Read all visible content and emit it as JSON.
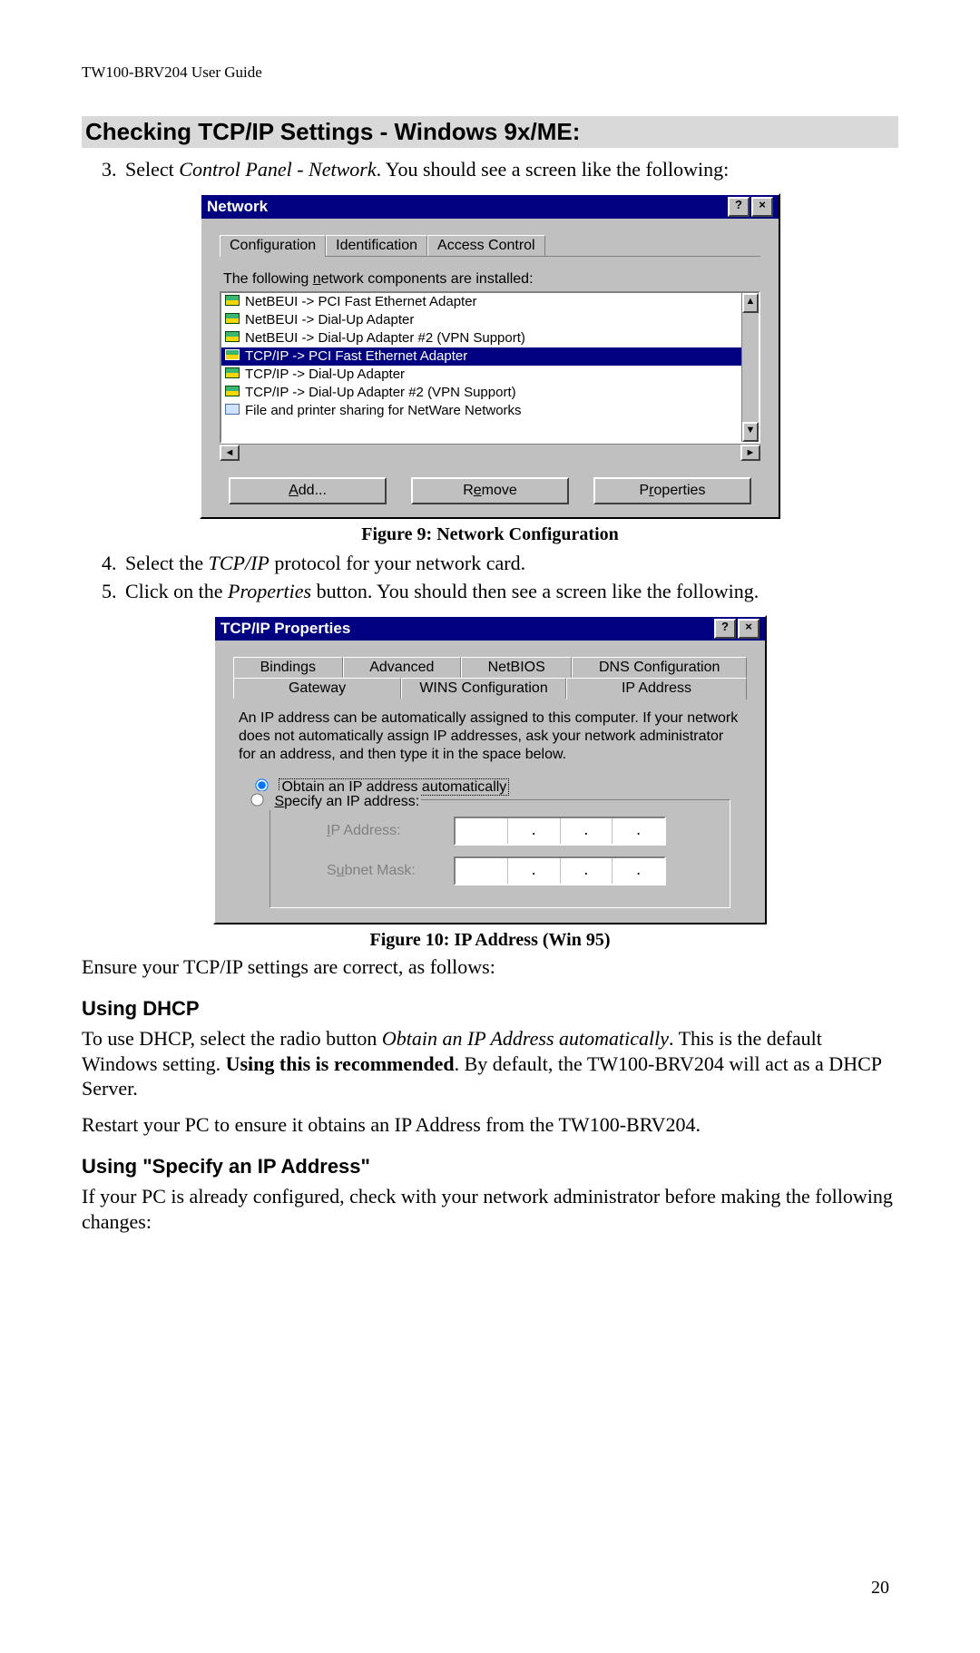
{
  "doc_header": "TW100-BRV204 User Guide",
  "section_title": "Checking TCP/IP Settings - Windows 9x/ME:",
  "step3_pre": "Select ",
  "step3_ital": "Control Panel - Network",
  "step3_post": ". You should see a screen like the following:",
  "fig9_caption": "Figure 9: Network Configuration",
  "step4_pre": "Select the ",
  "step4_ital": "TCP/IP",
  "step4_post": " protocol for your network card.",
  "step5_pre": "Click on the ",
  "step5_ital": "Properties",
  "step5_post": " button. You should then see a screen like the following.",
  "fig10_caption": "Figure 10: IP Address (Win 95)",
  "ensure_line": "Ensure your TCP/IP settings are correct, as follows:",
  "dhcp_heading": "Using DHCP",
  "dhcp_p_pre": "To use DHCP, select the radio button ",
  "dhcp_p_ital": "Obtain an IP Address automatically",
  "dhcp_p_mid": ". This is the default Windows setting. ",
  "dhcp_p_bold": "Using this is recommended",
  "dhcp_p_post": ". By default, the TW100-BRV204 will act as a DHCP Server.",
  "dhcp_restart": "Restart your PC to ensure it obtains an IP Address from the TW100-BRV204.",
  "specify_heading": "Using \"Specify an IP Address\"",
  "specify_p": "If your PC is already configured, check with your network administrator before making the following changes:",
  "page_number": "20",
  "win1": {
    "title": "Network",
    "help_btn": "?",
    "close_btn": "×",
    "tabs": [
      "Configuration",
      "Identification",
      "Access Control"
    ],
    "list_label_pre": "The following ",
    "list_label_ukey": "n",
    "list_label_post": "etwork components are installed:",
    "items": [
      "NetBEUI -> PCI Fast Ethernet Adapter",
      "NetBEUI -> Dial-Up Adapter",
      "NetBEUI -> Dial-Up Adapter #2 (VPN Support)",
      "TCP/IP -> PCI Fast Ethernet Adapter",
      "TCP/IP -> Dial-Up Adapter",
      "TCP/IP -> Dial-Up Adapter #2 (VPN Support)",
      "File and printer sharing for NetWare Networks"
    ],
    "selected_index": 3,
    "file_item_index": 6,
    "btn_add": "Add...",
    "btn_remove": "Remove",
    "btn_prop": "Properties",
    "btn_add_u": "A",
    "btn_remove_u": "e",
    "btn_prop_u": "r"
  },
  "win2": {
    "title": "TCP/IP Properties",
    "tabs_row1": [
      "Bindings",
      "Advanced",
      "NetBIOS",
      "DNS Configuration"
    ],
    "tabs_row2": [
      "Gateway",
      "WINS Configuration",
      "IP Address"
    ],
    "active_tab": "IP Address",
    "paragraph": "An IP address can be automatically assigned to this computer. If your network does not automatically assign IP addresses, ask your network administrator for an address, and then type it in the space below.",
    "radio_auto_pre": "O",
    "radio_auto_rest": "btain an IP address automatically",
    "radio_spec_pre": "S",
    "radio_spec_rest": "pecify an IP address:",
    "ip_label": "IP Address:",
    "mask_label": "Subnet Mask:",
    "ip_dot": "."
  }
}
